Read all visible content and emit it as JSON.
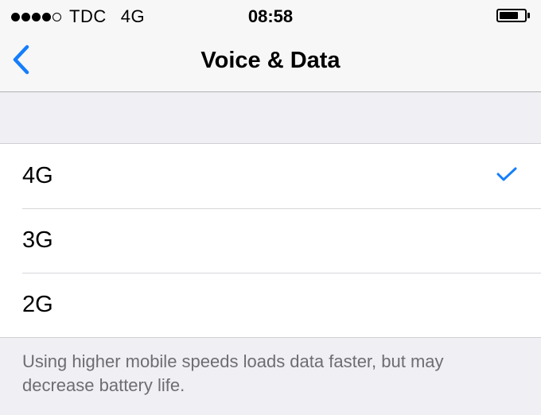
{
  "status_bar": {
    "carrier": "TDC",
    "network": "4G",
    "time": "08:58",
    "signal_bars": 4,
    "signal_max": 5,
    "battery_level": 0.75
  },
  "nav": {
    "back_icon": "chevron-left-icon",
    "title": "Voice & Data"
  },
  "options": [
    {
      "label": "4G",
      "selected": true
    },
    {
      "label": "3G",
      "selected": false
    },
    {
      "label": "2G",
      "selected": false
    }
  ],
  "footer": {
    "text": "Using higher mobile speeds loads data faster, but may decrease battery life."
  },
  "colors": {
    "accent": "#157efb",
    "background": "#efeff4",
    "footer_text": "#6d6d72"
  }
}
